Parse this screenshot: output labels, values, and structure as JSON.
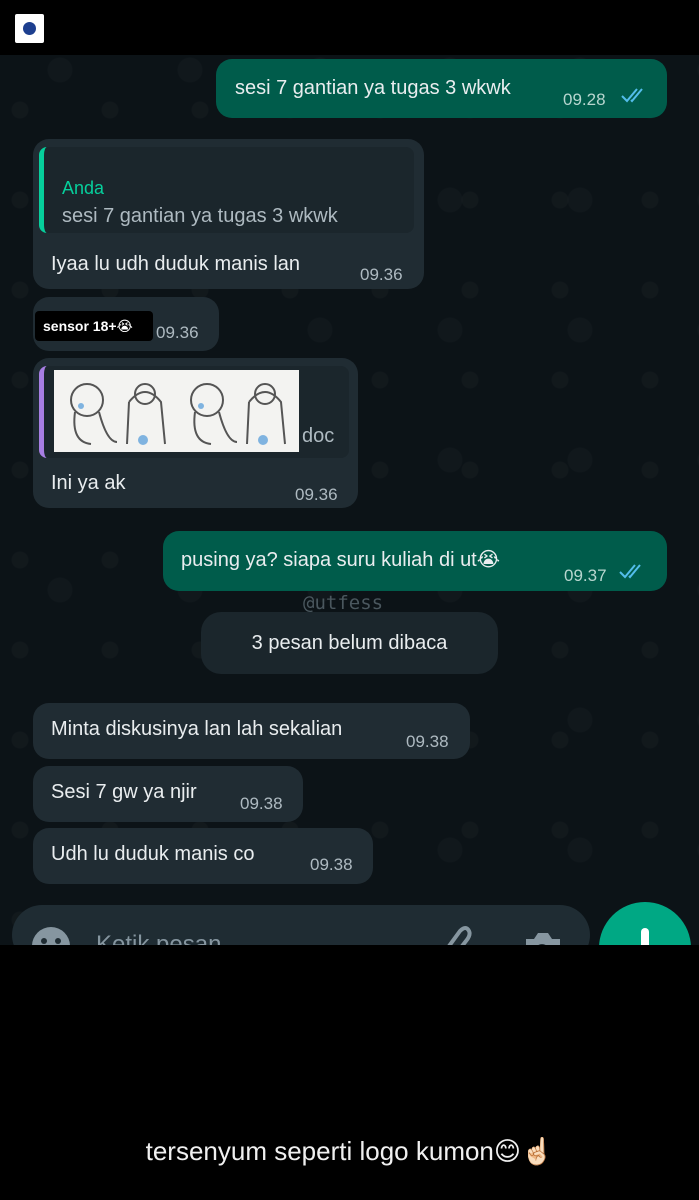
{
  "header": {
    "logo": "university-seal"
  },
  "messages": [
    {
      "dir": "out",
      "text": "sesi 7 gantian ya tugas 3 wkwk",
      "time": "09.28",
      "status": "read"
    },
    {
      "dir": "in",
      "quote_name": "Anda",
      "quote_text": "sesi 7 gantian ya tugas 3 wkwk",
      "text": "Iyaa lu udh duduk manis lan",
      "time": "09.36"
    },
    {
      "dir": "in",
      "sticker_label": "sensor 18+😭",
      "time": "09.36"
    },
    {
      "dir": "in",
      "quote_suffix": "doc",
      "text": "Ini ya ak",
      "time": "09.36"
    },
    {
      "dir": "out",
      "text": "pusing ya? siapa suru kuliah di ut😭",
      "time": "09.37",
      "status": "read"
    }
  ],
  "watermark": "@utfess",
  "unread_label": "3 pesan belum dibaca",
  "messages2": [
    {
      "text": "Minta diskusinya lan lah sekalian",
      "time": "09.38"
    },
    {
      "text": "Sesi 7 gw ya njir",
      "time": "09.38"
    },
    {
      "text": "Udh lu duduk manis co",
      "time": "09.38"
    }
  ],
  "input": {
    "placeholder": "Ketik pesan"
  },
  "icons": {
    "emoji": "emoji-icon",
    "attach": "paperclip-icon",
    "camera": "camera-icon",
    "mic": "mic-icon"
  },
  "caption": "tersenyum seperti logo kumon😊☝🏻",
  "colors": {
    "out_bubble": "#005c4b",
    "in_bubble": "#202c33",
    "accent": "#00a884",
    "background": "#0c1317"
  }
}
